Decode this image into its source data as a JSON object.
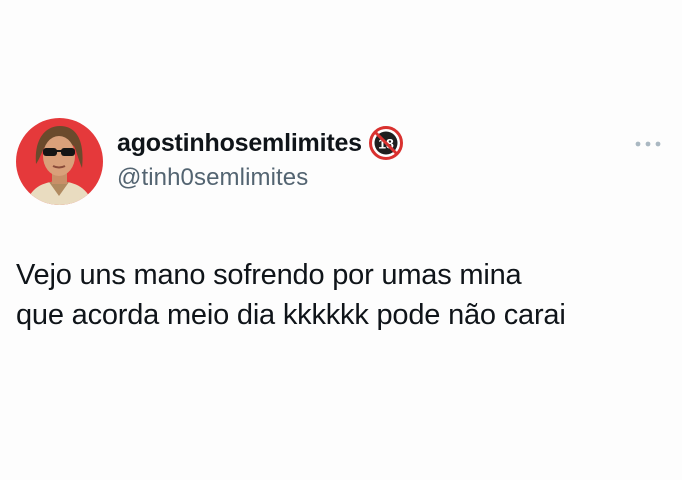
{
  "tweet": {
    "author": {
      "display_name": "agostinhosemlimites",
      "handle": "@tinh0semlimites",
      "badge_icon": "18-plus-badge-icon",
      "badge_text": "18",
      "avatar_bg": "#e5393b"
    },
    "more_icon": "more-dots-icon",
    "text_lines": [
      "Vejo uns mano sofrendo por umas mina",
      "que acorda meio dia kkkkkk pode não carai"
    ]
  }
}
